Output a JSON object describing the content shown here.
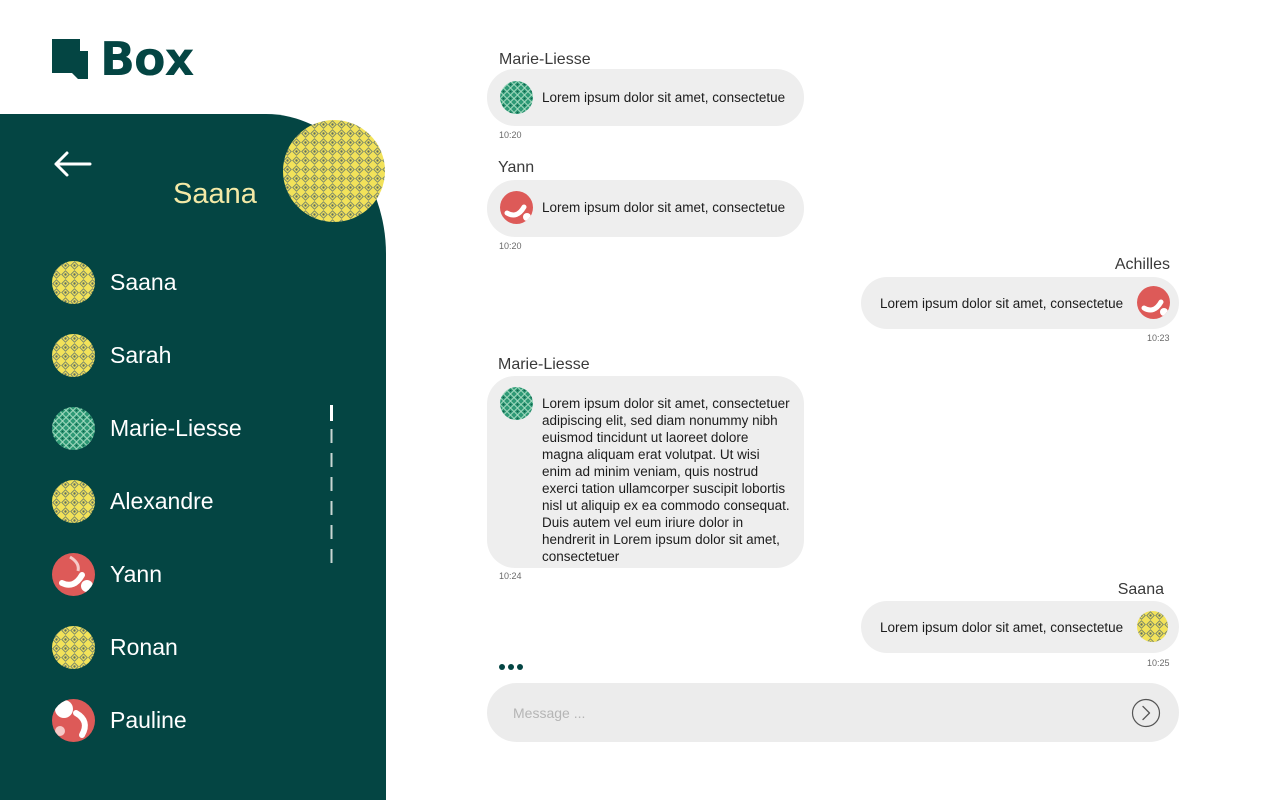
{
  "brand": {
    "name": "Box",
    "color": "#044543"
  },
  "colors": {
    "sidebar": "#044543",
    "accent_name": "#f3e9a6",
    "bubble": "#eeeeee"
  },
  "sidebar": {
    "current_contact": {
      "name": "Saana",
      "avatar": "yellow-pattern-avatar"
    },
    "contacts": [
      {
        "name": "Saana",
        "avatar": "yellow-pattern-avatar"
      },
      {
        "name": "Sarah",
        "avatar": "yellow-pattern-avatar"
      },
      {
        "name": "Marie-Liesse",
        "avatar": "green-pattern-avatar"
      },
      {
        "name": "Alexandre",
        "avatar": "yellow-pattern-avatar"
      },
      {
        "name": "Yann",
        "avatar": "red-pattern-avatar"
      },
      {
        "name": "Ronan",
        "avatar": "yellow-pattern-avatar"
      },
      {
        "name": "Pauline",
        "avatar": "red-pattern-avatar"
      }
    ]
  },
  "chat": {
    "messages": [
      {
        "sender": "Marie-Liesse",
        "text": "Lorem ipsum dolor sit amet, consectetue",
        "time": "10:20",
        "side": "left",
        "avatar": "green-pattern-avatar"
      },
      {
        "sender": "Yann",
        "text": "Lorem ipsum dolor sit amet, consectetue",
        "time": "10:20",
        "side": "left",
        "avatar": "red-pattern-avatar"
      },
      {
        "sender": "Achilles",
        "text": "Lorem ipsum dolor sit amet, consectetue",
        "time": "10:23",
        "side": "right",
        "avatar": "red-pattern-avatar"
      },
      {
        "sender": "Marie-Liesse",
        "text": "Lorem ipsum dolor sit amet, consectetuer adipiscing elit, sed diam nonummy nibh euismod tincidunt ut laoreet dolore magna aliquam erat volutpat. Ut wisi enim ad minim veniam, quis nostrud exerci tation ullamcorper suscipit lobortis nisl ut aliquip ex ea commodo consequat. Duis autem vel eum iriure dolor in hendrerit in Lorem ipsum dolor sit amet, consectetuer",
        "time": "10:24",
        "side": "left",
        "avatar": "green-pattern-avatar"
      },
      {
        "sender": "Saana",
        "text": "Lorem ipsum dolor sit amet, consectetue",
        "time": "10:25",
        "side": "right",
        "avatar": "yellow-pattern-avatar"
      }
    ],
    "typing_indicator": "typing-dots-icon"
  },
  "composer": {
    "placeholder": "Message ...",
    "value": "",
    "send_icon": "send-arrow-icon"
  }
}
